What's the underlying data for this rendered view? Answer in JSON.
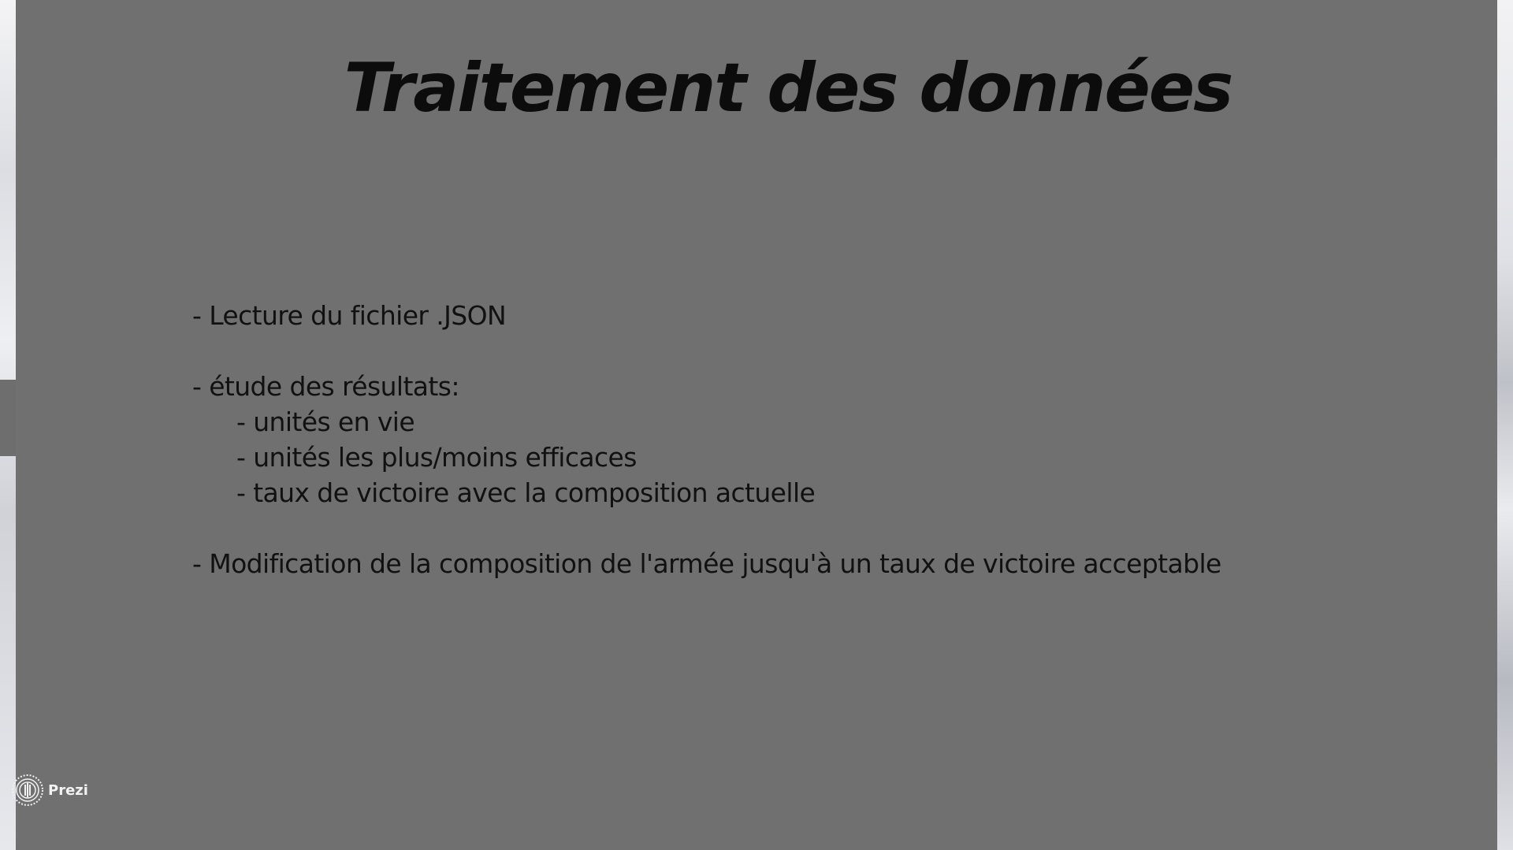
{
  "slide": {
    "title": "Traitement des données",
    "lines": [
      "- Lecture du fichier .JSON",
      "- étude des résultats:",
      "- unités en vie",
      "- unités les plus/moins efficaces",
      "- taux de victoire avec la composition actuelle",
      "- Modification de la composition de l'armée jusqu'à un taux de victoire acceptable"
    ]
  },
  "branding": {
    "label": "Prezi",
    "icon": "prezi-logo-icon"
  }
}
